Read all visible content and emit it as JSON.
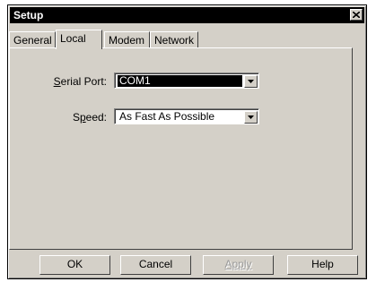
{
  "window": {
    "title": "Setup"
  },
  "tabs": [
    {
      "label": "General",
      "active": false
    },
    {
      "label": "Local",
      "active": true
    },
    {
      "label": "Modem",
      "active": false
    },
    {
      "label": "Network",
      "active": false
    }
  ],
  "local": {
    "serial_port": {
      "label": "Serial Port:",
      "mnemonic": "S",
      "rest": "erial Port:",
      "value": "COM1"
    },
    "speed": {
      "label": "Speed:",
      "prefix": "S",
      "mnemonic": "p",
      "rest": "eed:",
      "value": "As Fast As Possible"
    }
  },
  "buttons": {
    "ok": "OK",
    "cancel": "Cancel",
    "apply": "Apply",
    "help": "Help"
  },
  "icons": {
    "close": "close-icon",
    "dropdown": "chevron-down-icon"
  },
  "colors": {
    "face": "#d4d0c8",
    "titlebar": "#000000",
    "selection": "#000000"
  }
}
